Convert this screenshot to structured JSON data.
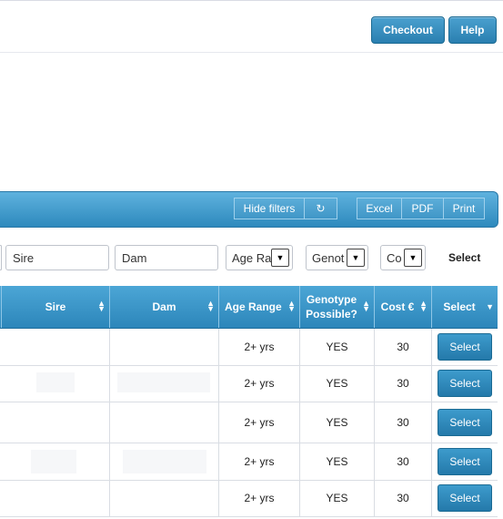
{
  "header": {
    "checkout_label": "Checkout",
    "help_label": "Help"
  },
  "toolbar": {
    "hide_filters_label": "Hide filters",
    "refresh_icon": "↻",
    "excel_label": "Excel",
    "pdf_label": "PDF",
    "print_label": "Print"
  },
  "filters": {
    "sire_placeholder": "Sire",
    "dam_placeholder": "Dam",
    "age_range_value": "Age Ra",
    "genotype_value": "Genot",
    "cost_value": "Co",
    "select_label": "Select"
  },
  "table": {
    "headers": [
      "Sire",
      "Dam",
      "Age Range",
      "Genotype Possible?",
      "Cost €",
      "Select"
    ],
    "rows": [
      {
        "age_range": "2+ yrs",
        "genotype": "YES",
        "cost": "30",
        "action": "Select"
      },
      {
        "age_range": "2+ yrs",
        "genotype": "YES",
        "cost": "30",
        "action": "Select"
      },
      {
        "age_range": "2+ yrs",
        "genotype": "YES",
        "cost": "30",
        "action": "Select"
      },
      {
        "age_range": "2+ yrs",
        "genotype": "YES",
        "cost": "30",
        "action": "Select"
      },
      {
        "age_range": "2+ yrs",
        "genotype": "YES",
        "cost": "30",
        "action": "Select"
      }
    ]
  },
  "colors": {
    "accent": "#2c86ba",
    "button": "#2a7fb0"
  }
}
